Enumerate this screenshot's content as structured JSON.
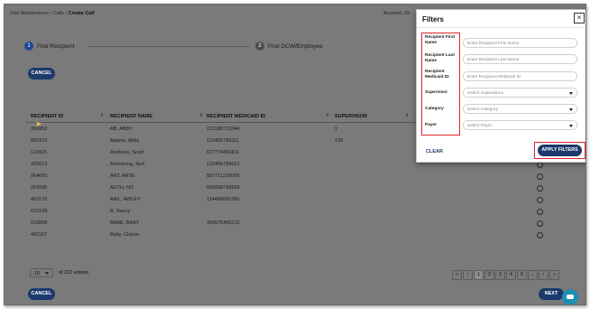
{
  "breadcrumb": {
    "parts": [
      "Visit Maintenance",
      "Calls",
      "Create Call"
    ],
    "sep": " / "
  },
  "account": "Account: 39",
  "steps": [
    {
      "number": "1",
      "label": "Find Recipient"
    },
    {
      "number": "2",
      "label": "Find DCW/Employee"
    }
  ],
  "buttons": {
    "cancel_top": "CANCEL",
    "cancel_bottom": "CANCEL",
    "next": "NEXT"
  },
  "table": {
    "headers": [
      "RECIPIENT ID",
      "RECIPIENT NAME",
      "RECIPIENT MEDICAID ID",
      "SUPERVISOR"
    ],
    "sort_icon": "⇕",
    "rows": [
      {
        "id": "369952",
        "name": "AB, ABBY",
        "medicaid": "221188773344",
        "supervisor": "1"
      },
      {
        "id": "820372",
        "name": "Adams, Abby",
        "medicaid": "123456789111",
        "supervisor": "128"
      },
      {
        "id": "113415",
        "name": "Andrews, Scott",
        "medicaid": "677774493811",
        "supervisor": ""
      },
      {
        "id": "425013",
        "name": "Armstrong, Neil",
        "medicaid": "123456789021",
        "supervisor": ""
      },
      {
        "id": "954665",
        "name": "ART, ARTE",
        "medicaid": "557711220099",
        "supervisor": ""
      },
      {
        "id": "254335",
        "name": "AUTH, NO",
        "medicaid": "556668798659",
        "supervisor": ""
      },
      {
        "id": "463176",
        "name": "AWL, AWLEY",
        "medicaid": "114488665789",
        "supervisor": ""
      },
      {
        "id": "615108",
        "name": "B, Nancy",
        "medicaid": "",
        "supervisor": ""
      },
      {
        "id": "610808",
        "name": "BABE, BABY",
        "medicaid": "456578455212",
        "supervisor": ""
      },
      {
        "id": "461157",
        "name": "Baby, Clarice",
        "medicaid": "",
        "supervisor": ""
      }
    ]
  },
  "footer": {
    "per_page": "10",
    "entries_text": "of 232 entries",
    "pages": [
      "«",
      "‹",
      "1",
      "2",
      "3",
      "4",
      "5",
      "...",
      "›",
      "»"
    ],
    "active_page": "1"
  },
  "filters": {
    "title": "Filters",
    "close": "×",
    "fields": [
      {
        "label": "Recipient First Name",
        "placeholder": "Enter Recipient First Name",
        "type": "text"
      },
      {
        "label": "Recipient Last Name",
        "placeholder": "Enter Recipient Last Name",
        "type": "text"
      },
      {
        "label": "Recipient Medicaid ID",
        "placeholder": "Enter Recipient Medicaid ID",
        "type": "text"
      },
      {
        "label": "Supervisor",
        "placeholder": "Select Supervisors",
        "type": "select"
      },
      {
        "label": "Category",
        "placeholder": "Select Category",
        "type": "select"
      },
      {
        "label": "Payer",
        "placeholder": "Select Payer",
        "type": "select"
      }
    ],
    "clear": "CLEAR",
    "apply": "APPLY FILTERS"
  },
  "colors": {
    "brand": "#1b3a6b",
    "overlay": "#7a7a7a",
    "highlight": "#e0262b",
    "chat": "#1c8fb5"
  },
  "icons": [
    "close-icon",
    "sort-icon",
    "chevron-down-icon",
    "chat-icon",
    "cursor-icon"
  ]
}
